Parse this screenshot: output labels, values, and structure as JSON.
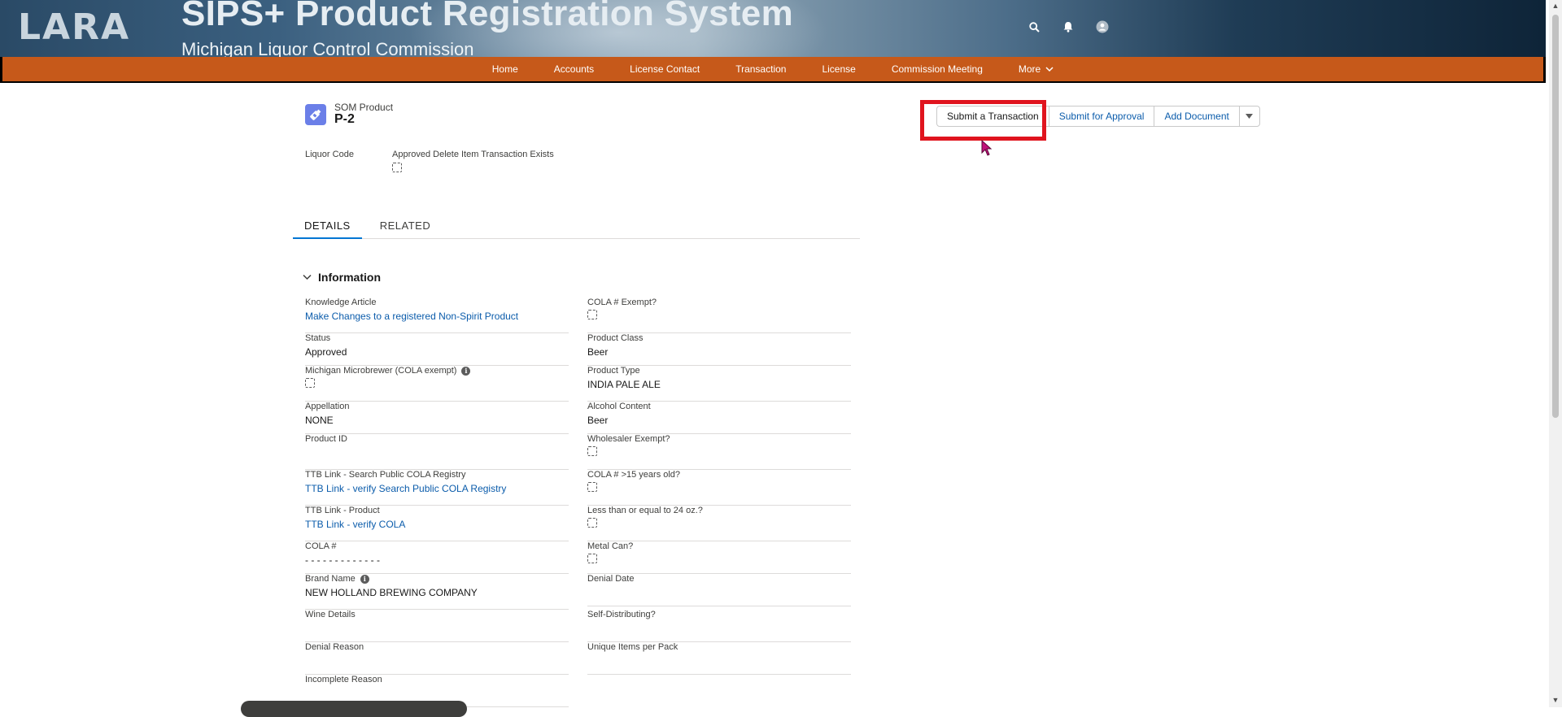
{
  "header": {
    "logo_text": "LARA",
    "app_title": "SIPS+ Product Registration System",
    "app_subtitle": "Michigan Liquor Control Commission"
  },
  "nav": {
    "items": [
      "Home",
      "Accounts",
      "License Contact",
      "Transaction",
      "License",
      "Commission Meeting",
      "More"
    ]
  },
  "record": {
    "object_type": "SOM Product",
    "name": "P-2",
    "highlights": {
      "liquor_code_label": "Liquor Code",
      "approved_delete_label": "Approved Delete Item Transaction Exists"
    }
  },
  "actions": {
    "submit_transaction": "Submit a Transaction",
    "submit_approval": "Submit for Approval",
    "add_document": "Add Document"
  },
  "tabs": [
    "DETAILS",
    "RELATED"
  ],
  "section": {
    "title": "Information"
  },
  "fields_left": [
    {
      "label": "Knowledge Article",
      "value": "Make Changes to a registered Non-Spirit Product",
      "type": "link"
    },
    {
      "label": "Status",
      "value": "Approved",
      "type": "text"
    },
    {
      "label": "Michigan Microbrewer (COLA exempt)",
      "value": "",
      "type": "checkbox",
      "info": true
    },
    {
      "label": "Appellation",
      "value": "NONE",
      "type": "text"
    },
    {
      "label": "Product ID",
      "value": "",
      "type": "text"
    },
    {
      "label": "TTB Link - Search Public COLA Registry",
      "value": "TTB Link - verify Search Public COLA Registry",
      "type": "link"
    },
    {
      "label": "TTB Link - Product",
      "value": "TTB Link - verify COLA",
      "type": "link"
    },
    {
      "label": "COLA #",
      "value": "- - - - - - - - - - - - -",
      "type": "text"
    },
    {
      "label": "Brand Name",
      "value": "NEW HOLLAND BREWING COMPANY",
      "type": "text",
      "info": true
    },
    {
      "label": "Wine Details",
      "value": "",
      "type": "text"
    },
    {
      "label": "Denial Reason",
      "value": "",
      "type": "text"
    },
    {
      "label": "Incomplete Reason",
      "value": "",
      "type": "text"
    }
  ],
  "fields_right": [
    {
      "label": "COLA # Exempt?",
      "value": "",
      "type": "checkbox"
    },
    {
      "label": "Product Class",
      "value": "Beer",
      "type": "text"
    },
    {
      "label": "Product Type",
      "value": "INDIA PALE ALE",
      "type": "text"
    },
    {
      "label": "Alcohol Content",
      "value": "Beer",
      "type": "text"
    },
    {
      "label": "Wholesaler Exempt?",
      "value": "",
      "type": "checkbox"
    },
    {
      "label": "COLA # >15 years old?",
      "value": "",
      "type": "checkbox"
    },
    {
      "label": "Less than or equal to 24 oz.?",
      "value": "",
      "type": "checkbox"
    },
    {
      "label": "Metal Can?",
      "value": "",
      "type": "checkbox"
    },
    {
      "label": "Denial Date",
      "value": "",
      "type": "text"
    },
    {
      "label": "Self-Distributing?",
      "value": "",
      "type": "text"
    },
    {
      "label": "Unique Items per Pack",
      "value": "",
      "type": "text"
    }
  ],
  "icons": {
    "search": "search-icon",
    "notifications": "bell-icon",
    "user": "user-avatar-icon",
    "record": "bottle-icon"
  },
  "colors": {
    "nav_bg": "#c6591a",
    "record_icon": "#6b7fe8",
    "highlight_box": "#e0141e",
    "link": "#0b5cab",
    "tab_active": "#0176d3"
  }
}
